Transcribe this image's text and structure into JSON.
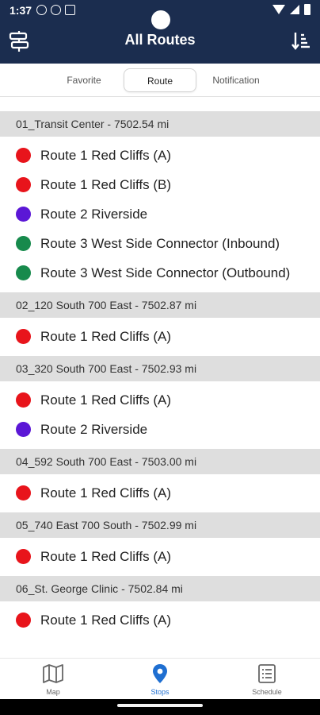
{
  "status_bar": {
    "time": "1:37"
  },
  "header": {
    "title": "All Routes",
    "left_icon": "signpost-icon",
    "right_icon": "sort-icon"
  },
  "tabs": [
    {
      "label": "Favorite",
      "active": false
    },
    {
      "label": "Route",
      "active": true
    },
    {
      "label": "Notification",
      "active": false
    }
  ],
  "colors": {
    "header_bg": "#1b2d4f",
    "section_bg": "#dedede",
    "route_red": "#e8141b",
    "route_purple": "#5b17d6",
    "route_green": "#178a4c",
    "active_nav": "#1f6fd1"
  },
  "stops": [
    {
      "label": "01_Transit Center - 7502.54 mi",
      "routes": [
        {
          "name": "Route 1 Red Cliffs (A)",
          "color": "#e8141b"
        },
        {
          "name": "Route 1 Red Cliffs (B)",
          "color": "#e8141b"
        },
        {
          "name": "Route 2 Riverside",
          "color": "#5b17d6"
        },
        {
          "name": "Route 3 West Side Connector (Inbound)",
          "color": "#178a4c"
        },
        {
          "name": "Route 3 West Side Connector (Outbound)",
          "color": "#178a4c"
        }
      ]
    },
    {
      "label": "02_120 South 700 East - 7502.87 mi",
      "routes": [
        {
          "name": "Route 1 Red Cliffs (A)",
          "color": "#e8141b"
        }
      ]
    },
    {
      "label": "03_320 South 700 East - 7502.93 mi",
      "routes": [
        {
          "name": "Route 1 Red Cliffs (A)",
          "color": "#e8141b"
        },
        {
          "name": "Route 2 Riverside",
          "color": "#5b17d6"
        }
      ]
    },
    {
      "label": "04_592 South 700 East - 7503.00 mi",
      "routes": [
        {
          "name": "Route 1 Red Cliffs (A)",
          "color": "#e8141b"
        }
      ]
    },
    {
      "label": "05_740 East 700 South - 7502.99 mi",
      "routes": [
        {
          "name": "Route 1 Red Cliffs (A)",
          "color": "#e8141b"
        }
      ]
    },
    {
      "label": "06_St. George Clinic - 7502.84 mi",
      "routes": [
        {
          "name": "Route 1 Red Cliffs (A)",
          "color": "#e8141b"
        }
      ]
    }
  ],
  "bottom_nav": [
    {
      "label": "Map",
      "icon": "map-icon",
      "active": false
    },
    {
      "label": "Stops",
      "icon": "location-pin-icon",
      "active": true
    },
    {
      "label": "Schedule",
      "icon": "schedule-list-icon",
      "active": false
    }
  ]
}
